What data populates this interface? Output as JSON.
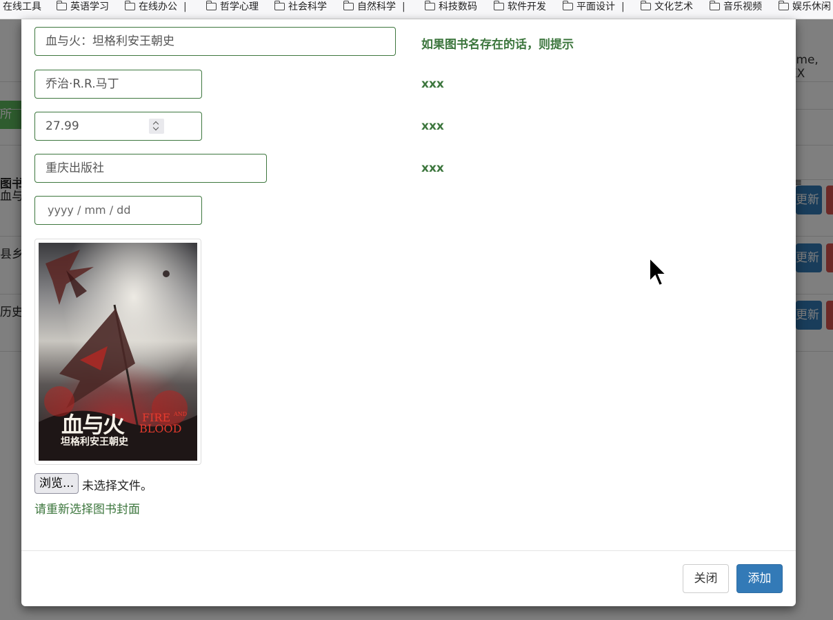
{
  "bookmarks": [
    {
      "label": "在线工具",
      "folder": false,
      "sep": false
    },
    {
      "label": "英语学习",
      "folder": true,
      "sep": false
    },
    {
      "label": "在线办公",
      "folder": true,
      "sep": true
    },
    {
      "label": "哲学心理",
      "folder": true,
      "sep": false
    },
    {
      "label": "社会科学",
      "folder": true,
      "sep": false
    },
    {
      "label": "自然科学",
      "folder": true,
      "sep": true
    },
    {
      "label": "科技数码",
      "folder": true,
      "sep": false
    },
    {
      "label": "软件开发",
      "folder": true,
      "sep": false
    },
    {
      "label": "平面设计",
      "folder": true,
      "sep": true
    },
    {
      "label": "文化艺术",
      "folder": true,
      "sep": false
    },
    {
      "label": "音乐视频",
      "folder": true,
      "sep": false
    },
    {
      "label": "娱乐休闲",
      "folder": true,
      "sep": false
    }
  ],
  "background": {
    "welcome": "ome, XX",
    "green_button": "所有",
    "header_col": "图书",
    "rows": [
      "血与",
      "县乡",
      "历史"
    ],
    "update_label": "更新"
  },
  "form": {
    "book_name": "血与火：坦格利安王朝史",
    "book_name_hint": "如果图书名存在的话，则提示",
    "author": "乔治·R.R.马丁",
    "author_hint": "xxx",
    "price": "27.99",
    "price_hint": "xxx",
    "publisher": "重庆出版社",
    "publisher_hint": "xxx",
    "date_placeholder": "yyyy / mm / dd",
    "cover": {
      "title_cn": "血与火",
      "subtitle_cn": "坦格利安王朝史",
      "title_en_1": "FIRE",
      "title_en_2": "AND",
      "title_en_3": "BLOOD"
    },
    "browse_label": "浏览...",
    "file_status": "未选择文件。",
    "reselect_hint": "请重新选择图书封面"
  },
  "footer": {
    "close_label": "关闭",
    "add_label": "添加"
  },
  "colors": {
    "success_green": "#3c763d",
    "primary_blue": "#337ab7"
  }
}
